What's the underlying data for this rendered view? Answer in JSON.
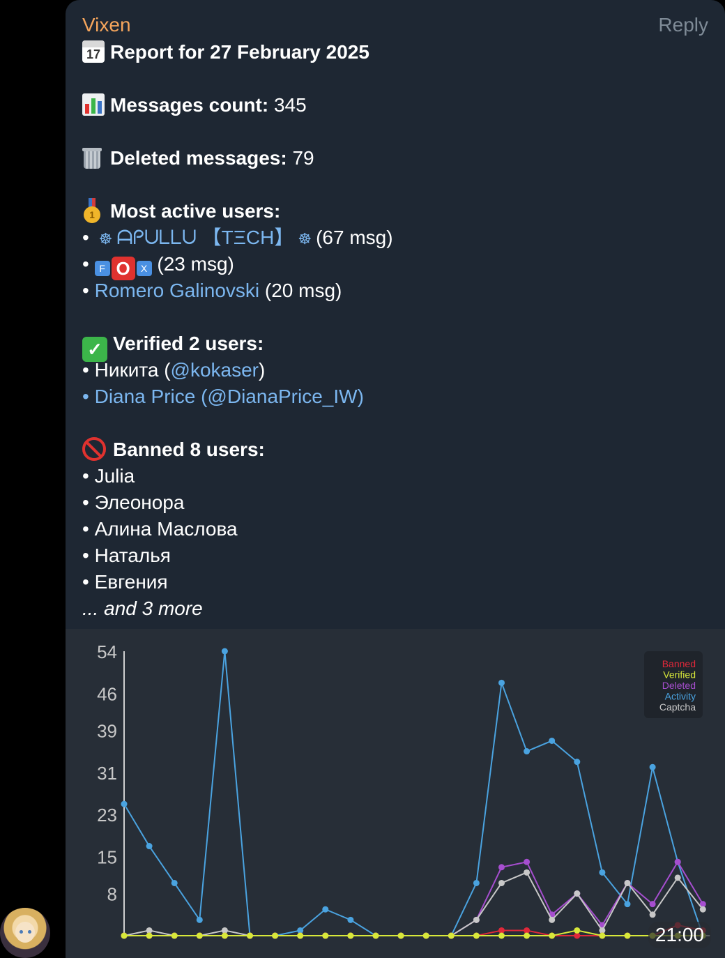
{
  "message": {
    "sender": "Vixen",
    "reply_label": "Reply",
    "time": "21:00",
    "report_title": "Report for 27 February 2025",
    "calendar_day": "17",
    "messages_label": "Messages count:",
    "messages_value": "345",
    "deleted_label": "Deleted messages:",
    "deleted_value": "79",
    "active_label": "Most active users:",
    "active_users": [
      {
        "name": "ᗩᑭᑌᒪᒪᑌ 【TΞCH】",
        "count": "(67 msg)"
      },
      {
        "name_parts": [
          "F",
          "O",
          "X"
        ],
        "count": "(23 msg)"
      },
      {
        "name": "Romero Galinovski",
        "count": "(20 msg)"
      }
    ],
    "verified_label": "Verified 2 users:",
    "verified_users": [
      {
        "name": "Никита (",
        "handle": "@kokaser",
        "suffix": ")"
      },
      {
        "name": "Diana Price (@DianaPrice_IW)"
      }
    ],
    "banned_label": "Banned 8 users:",
    "banned_users": [
      "Julia",
      "Элеонора",
      "Алина Маслова",
      "Наталья",
      "Евгения"
    ],
    "more": "... and 3 more",
    "bullet": "•"
  },
  "colors": {
    "banned": "#e0283a",
    "verified": "#d8e83a",
    "deleted": "#a64ecf",
    "activity": "#4aa3e0",
    "captcha": "#c8c8c8"
  },
  "chart_data": {
    "type": "line",
    "x": [
      0,
      1,
      2,
      3,
      4,
      5,
      6,
      7,
      8,
      9,
      10,
      11,
      12,
      13,
      14,
      15,
      16,
      17,
      18,
      19,
      20,
      21,
      22,
      23
    ],
    "ylim": [
      0,
      54
    ],
    "yticks": [
      "54",
      "46",
      "39",
      "31",
      "23",
      "15",
      "8"
    ],
    "ytick_values": [
      54,
      46,
      39,
      31,
      23,
      15,
      8
    ],
    "legend": [
      "Banned",
      "Verified",
      "Deleted",
      "Activity",
      "Captcha"
    ],
    "series": [
      {
        "name": "Activity",
        "values": [
          25,
          17,
          10,
          3,
          54,
          0,
          0,
          1,
          5,
          3,
          0,
          0,
          0,
          0,
          10,
          48,
          35,
          37,
          33,
          12,
          6,
          32,
          14,
          0
        ]
      },
      {
        "name": "Deleted",
        "values": [
          0,
          0,
          0,
          0,
          0,
          0,
          0,
          0,
          0,
          0,
          0,
          0,
          0,
          0,
          3,
          13,
          14,
          4,
          8,
          2,
          10,
          6,
          14,
          6
        ]
      },
      {
        "name": "Captcha",
        "values": [
          0,
          1,
          0,
          0,
          1,
          0,
          0,
          0,
          0,
          0,
          0,
          0,
          0,
          0,
          3,
          10,
          12,
          3,
          8,
          1,
          10,
          4,
          11,
          5
        ]
      },
      {
        "name": "Banned",
        "values": [
          0,
          0,
          0,
          0,
          0,
          0,
          0,
          0,
          0,
          0,
          0,
          0,
          0,
          0,
          0,
          1,
          1,
          0,
          0,
          0,
          0,
          0,
          2,
          1
        ]
      },
      {
        "name": "Verified",
        "values": [
          0,
          0,
          0,
          0,
          0,
          0,
          0,
          0,
          0,
          0,
          0,
          0,
          0,
          0,
          0,
          0,
          0,
          0,
          1,
          0,
          0,
          0,
          0,
          0
        ]
      }
    ]
  }
}
